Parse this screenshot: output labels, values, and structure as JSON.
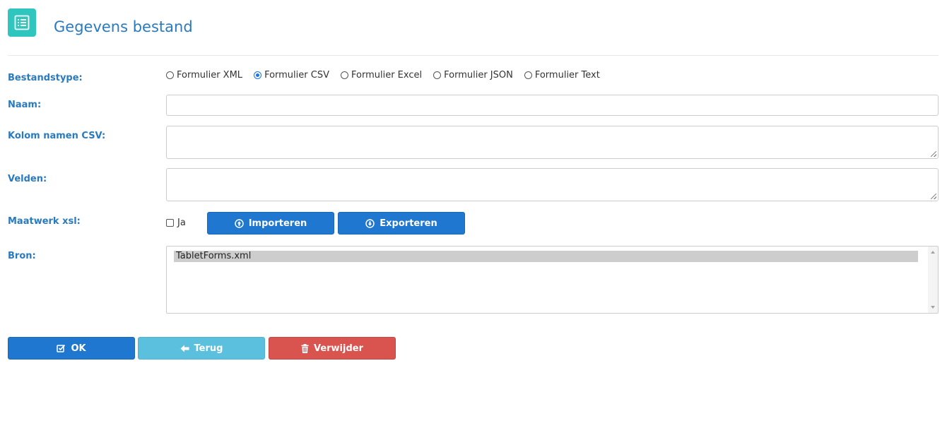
{
  "header": {
    "icon": "list-document-icon",
    "title": "Gegevens bestand"
  },
  "form": {
    "bestandstype": {
      "label": "Bestandstype:",
      "options": [
        {
          "label": "Formulier XML",
          "checked": false
        },
        {
          "label": "Formulier CSV",
          "checked": true
        },
        {
          "label": "Formulier Excel",
          "checked": false
        },
        {
          "label": "Formulier JSON",
          "checked": false
        },
        {
          "label": "Formulier Text",
          "checked": false
        }
      ]
    },
    "naam": {
      "label": "Naam:",
      "value": ""
    },
    "kolom_namen": {
      "label": "Kolom namen CSV:",
      "value": ""
    },
    "velden": {
      "label": "Velden:",
      "value": ""
    },
    "maatwerk": {
      "label": "Maatwerk xsl:",
      "checkbox_label": "Ja",
      "checked": false,
      "import_label": "Importeren",
      "export_label": "Exporteren"
    },
    "bron": {
      "label": "Bron:",
      "items": [
        "TabletForms.xml"
      ],
      "selected": "TabletForms.xml"
    }
  },
  "actions": {
    "ok_label": "OK",
    "back_label": "Terug",
    "delete_label": "Verwijder"
  },
  "colors": {
    "accent": "#2a7ac0",
    "primary_button": "#1f77d0",
    "info_button": "#5bc0de",
    "danger_button": "#d9534f",
    "icon_bg": "#2fc6c0"
  }
}
